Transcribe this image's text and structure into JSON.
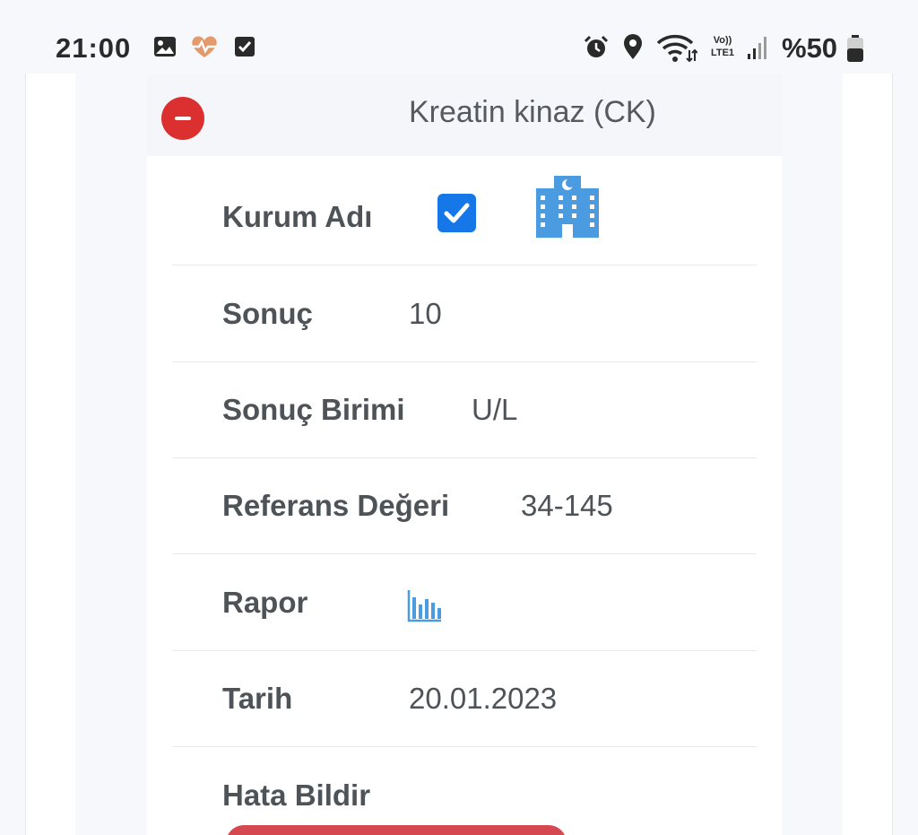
{
  "status_bar": {
    "time": "21:00",
    "battery": "%50",
    "network": "Vo))\nLTE1",
    "icons": [
      "gallery-icon",
      "health-icon",
      "task-check-icon",
      "alarm-icon",
      "location-icon",
      "wifi-icon",
      "volte-icon",
      "signal-icon",
      "battery-icon"
    ]
  },
  "card": {
    "title": "Kreatin kinaz (CK)",
    "rows": [
      {
        "label": "Kurum Adı",
        "value": ""
      },
      {
        "label": "Sonuç",
        "value": "10"
      },
      {
        "label": "Sonuç Birimi",
        "value": "U/L"
      },
      {
        "label": "Referans Değeri",
        "value": "34-145"
      },
      {
        "label": "Rapor",
        "value": ""
      },
      {
        "label": "Tarih",
        "value": "20.01.2023"
      },
      {
        "label": "Hata Bildir",
        "value": ""
      }
    ]
  },
  "colors": {
    "accent_blue": "#1677e8",
    "danger_red": "#dc3030",
    "icon_blue": "#4a9be0"
  }
}
